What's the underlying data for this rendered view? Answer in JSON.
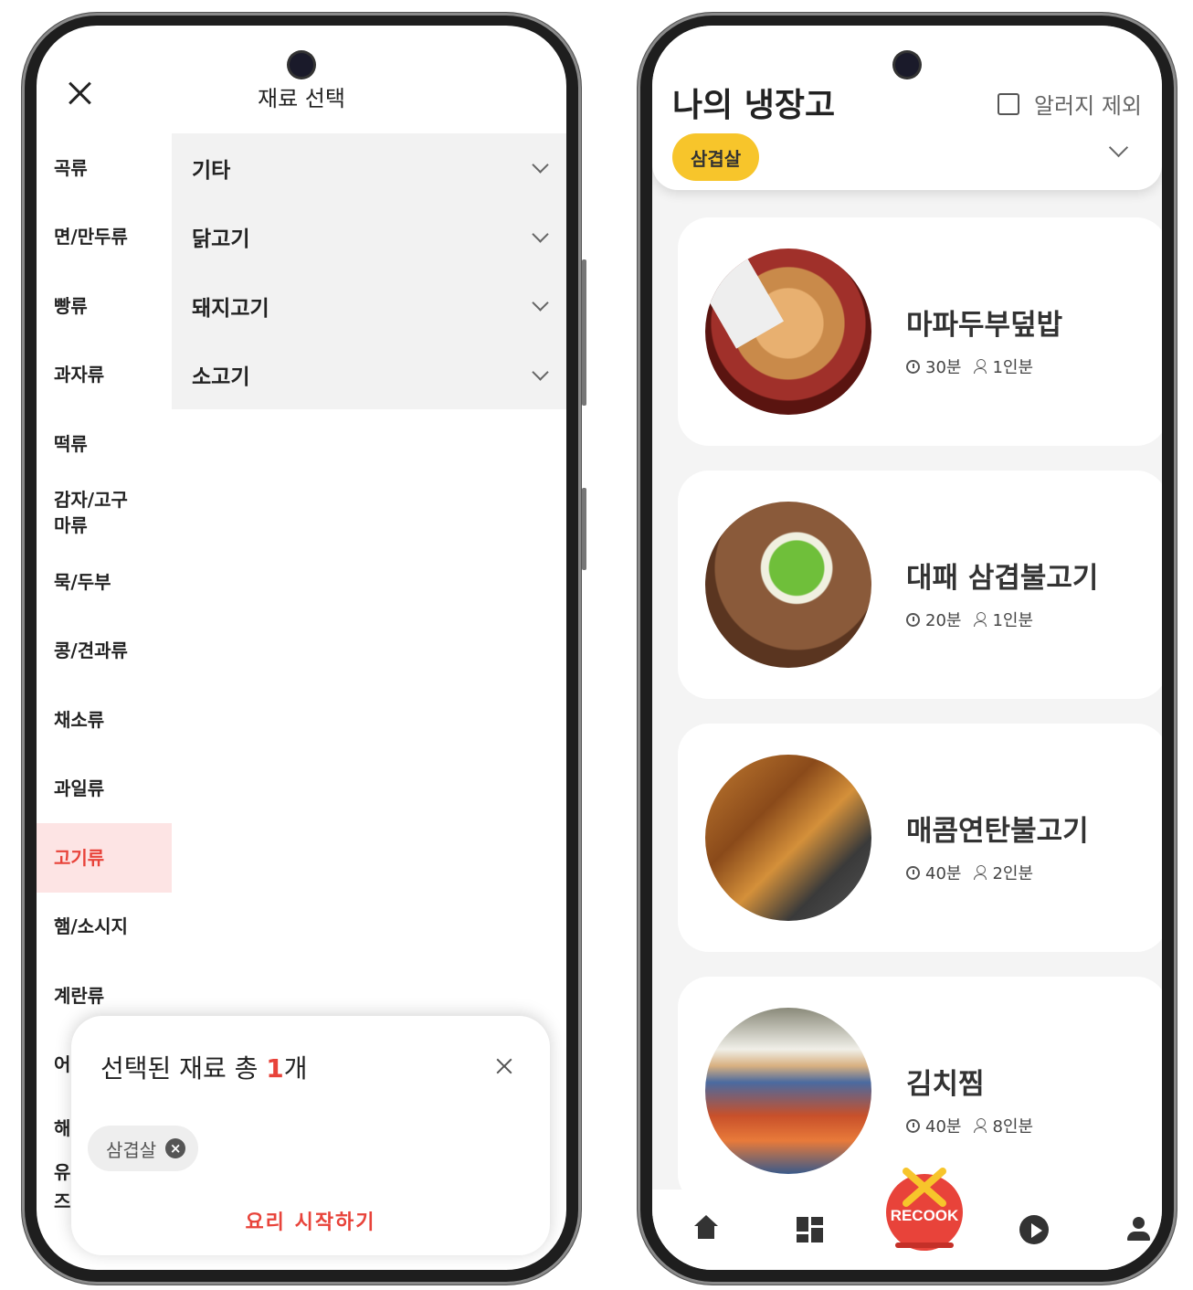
{
  "left_screen": {
    "title": "재료 선택",
    "categories": [
      "곡류",
      "면/만두류",
      "빵류",
      "과자류",
      "떡류",
      "감자/고구\n마류",
      "묵/두부",
      "콩/견과류",
      "채소류",
      "과일류",
      "고기류",
      "햄/소시지",
      "계란류",
      "어",
      "해",
      "유",
      "즈"
    ],
    "active_category": "고기류",
    "subcategories": [
      "기타",
      "닭고기",
      "돼지고기",
      "소고기"
    ],
    "sheet": {
      "title_prefix": "선택된 재료 총 ",
      "count": "1",
      "title_suffix": "개",
      "chip_label": "삼겹살",
      "chip_remove": "×",
      "start_label": "요리 시작하기"
    }
  },
  "right_screen": {
    "title": "나의 냉장고",
    "exclude_label": "알러지 제외",
    "tag": "삼겹살",
    "recipes": [
      {
        "name": "마파두부덮밥",
        "time": "30분",
        "servings": "1인분"
      },
      {
        "name": "대패 삼겹불고기",
        "time": "20분",
        "servings": "1인분"
      },
      {
        "name": "매콤연탄불고기",
        "time": "40분",
        "servings": "2인분"
      },
      {
        "name": "김치찜",
        "time": "40분",
        "servings": "8인분"
      }
    ],
    "logo_text": "RECOOK"
  },
  "colors": {
    "accent_red": "#e8433a",
    "tag_yellow": "#f7c52b",
    "active_bg": "#fde4e4"
  }
}
